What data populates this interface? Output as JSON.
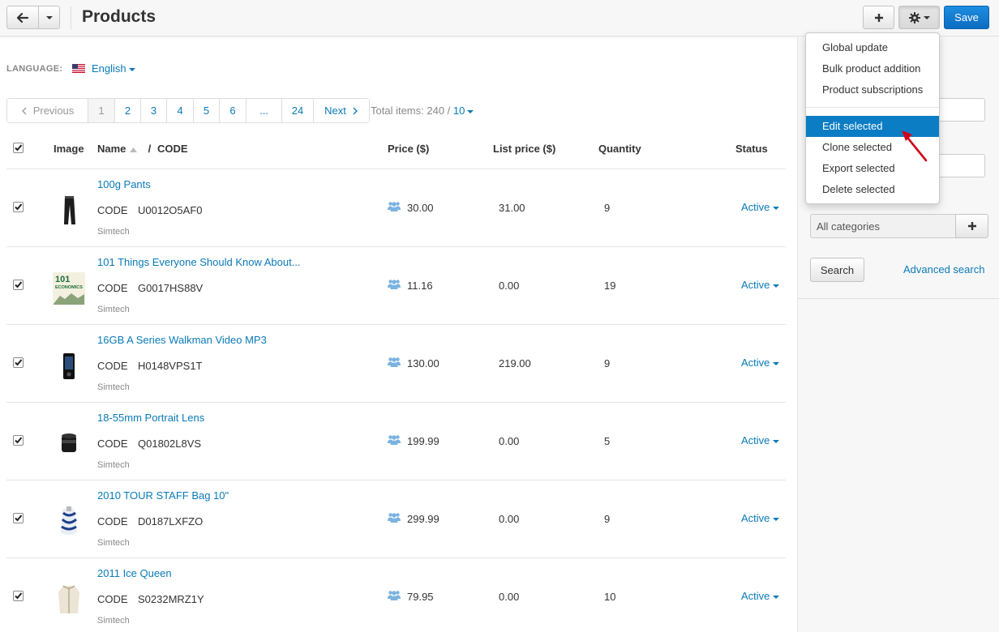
{
  "header": {
    "title": "Products",
    "save_label": "Save"
  },
  "language": {
    "label": "LANGUAGE:",
    "value": "English"
  },
  "pagination": {
    "previous": "Previous",
    "pages": [
      "1",
      "2",
      "3",
      "4",
      "5",
      "6",
      "...",
      "24"
    ],
    "current": "1",
    "next": "Next",
    "total_label": "Total items: 240 /",
    "per_page": "10"
  },
  "table": {
    "headers": {
      "image": "Image",
      "name": "Name",
      "separator": "/",
      "code": "CODE",
      "price": "Price ($)",
      "list_price": "List price ($)",
      "quantity": "Quantity",
      "status": "Status"
    },
    "code_label": "CODE",
    "rows": [
      {
        "name": "100g Pants",
        "code": "U0012O5AF0",
        "vendor": "Simtech",
        "price": "30.00",
        "list_price": "31.00",
        "quantity": "9",
        "status": "Active",
        "thumb": "pants"
      },
      {
        "name": "101 Things Everyone Should Know About...",
        "code": "G0017HS88V",
        "vendor": "Simtech",
        "price": "11.16",
        "list_price": "0.00",
        "quantity": "19",
        "status": "Active",
        "thumb": "book"
      },
      {
        "name": "16GB A Series Walkman Video MP3",
        "code": "H0148VPS1T",
        "vendor": "Simtech",
        "price": "130.00",
        "list_price": "219.00",
        "quantity": "9",
        "status": "Active",
        "thumb": "mp3"
      },
      {
        "name": "18-55mm Portrait Lens",
        "code": "Q01802L8VS",
        "vendor": "Simtech",
        "price": "199.99",
        "list_price": "0.00",
        "quantity": "5",
        "status": "Active",
        "thumb": "lens"
      },
      {
        "name": "2010 TOUR STAFF Bag 10\"",
        "code": "D0187LXFZO",
        "vendor": "Simtech",
        "price": "299.99",
        "list_price": "0.00",
        "quantity": "9",
        "status": "Active",
        "thumb": "bag"
      },
      {
        "name": "2011 Ice Queen",
        "code": "S0232MRZ1Y",
        "vendor": "Simtech",
        "price": "79.95",
        "list_price": "0.00",
        "quantity": "10",
        "status": "Active",
        "thumb": "jacket"
      }
    ]
  },
  "dropdown": {
    "group1": [
      "Global update",
      "Bulk product addition",
      "Product subscriptions"
    ],
    "group2": [
      "Edit selected",
      "Clone selected",
      "Export selected",
      "Delete selected"
    ],
    "active_item": "Edit selected"
  },
  "sidebar": {
    "category_value": "All categories",
    "search_label": "Search",
    "advanced_search": "Advanced search"
  },
  "colors": {
    "link": "#0a7ab8",
    "primary": "#0b6cc1",
    "active_item": "#0b7dc4",
    "annotation_arrow": "#d0021b"
  },
  "icons": [
    "back-arrow-icon",
    "chevron-down-icon",
    "plus-icon",
    "gear-icon",
    "us-flag-icon",
    "users-icon",
    "checkbox-checked-icon",
    "sort-asc-icon",
    "annotation-arrow-icon"
  ]
}
